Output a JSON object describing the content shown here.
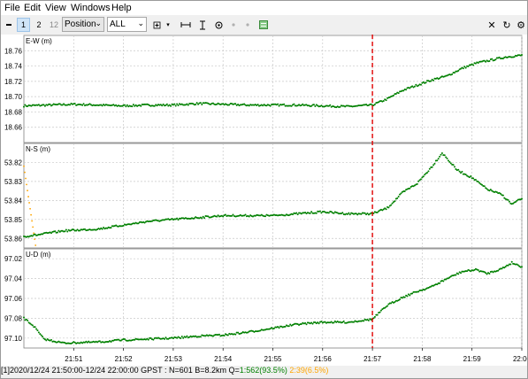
{
  "menu": [
    "File",
    "Edit",
    "View",
    "Windows",
    "Help"
  ],
  "toolbar": {
    "btn1": "1",
    "btn2": "2",
    "btn12": "12",
    "plot_type": "Position",
    "satellites": "ALL",
    "icons": [
      "menu-icon",
      "plus-icon",
      "dropdown-icon",
      "fit-horizontal-icon",
      "fit-vertical-icon",
      "center-icon",
      "dot-icon",
      "dot-icon",
      "map-icon",
      "close-icon",
      "refresh-icon",
      "settings-icon"
    ]
  },
  "colors": {
    "q1": "#008000",
    "q2": "#ffa500",
    "marker": "#e00000",
    "grid": "#c8c8c8"
  },
  "status": {
    "prefix": "[1]2020/12/24 21:50:00-12/24 22:00:00 GPST : N=601 B=8.2km Q=",
    "q1": "1:562(93.5%)",
    "q2": "2:39(6.5%)"
  },
  "chart_data": {
    "type": "scatter",
    "x_ticks": [
      "21:51",
      "21:52",
      "21:53",
      "21:54",
      "21:55",
      "21:56",
      "21:57",
      "21:58",
      "21:59",
      "22:00"
    ],
    "xlim": [
      "21:50:00",
      "22:00:00"
    ],
    "marker_time": "21:57:00",
    "panels": [
      {
        "label": "E-W (m)",
        "ylim": [
          18.64,
          18.78
        ],
        "yticks": [
          "18.66",
          "18.68",
          "18.70",
          "18.72",
          "18.74",
          "18.76"
        ],
        "points": [
          [
            0.0,
            18.688
          ],
          [
            0.5,
            18.689
          ],
          [
            1.0,
            18.69
          ],
          [
            1.5,
            18.689
          ],
          [
            2.0,
            18.688
          ],
          [
            2.5,
            18.689
          ],
          [
            3.0,
            18.689
          ],
          [
            3.5,
            18.691
          ],
          [
            4.0,
            18.69
          ],
          [
            4.5,
            18.689
          ],
          [
            5.0,
            18.689
          ],
          [
            5.5,
            18.689
          ],
          [
            6.0,
            18.688
          ],
          [
            6.5,
            18.687
          ],
          [
            7.0,
            18.689
          ],
          [
            7.3,
            18.697
          ],
          [
            7.6,
            18.708
          ],
          [
            7.9,
            18.715
          ],
          [
            8.2,
            18.722
          ],
          [
            8.5,
            18.727
          ],
          [
            8.8,
            18.737
          ],
          [
            9.1,
            18.744
          ],
          [
            9.4,
            18.748
          ],
          [
            9.7,
            18.752
          ],
          [
            10.0,
            18.754
          ]
        ]
      },
      {
        "label": "N-S (m)",
        "ylim": [
          53.865,
          53.81
        ],
        "yticks": [
          "53.82",
          "53.83",
          "53.84",
          "53.85",
          "53.86"
        ],
        "points": [
          [
            0.0,
            53.859
          ],
          [
            0.3,
            53.858
          ],
          [
            0.8,
            53.856
          ],
          [
            1.5,
            53.855
          ],
          [
            2.0,
            53.853
          ],
          [
            2.5,
            53.851
          ],
          [
            3.0,
            53.85
          ],
          [
            3.5,
            53.849
          ],
          [
            4.0,
            53.848
          ],
          [
            4.5,
            53.848
          ],
          [
            5.0,
            53.848
          ],
          [
            5.5,
            53.847
          ],
          [
            6.0,
            53.846
          ],
          [
            6.5,
            53.847
          ],
          [
            7.0,
            53.847
          ],
          [
            7.3,
            53.844
          ],
          [
            7.6,
            53.836
          ],
          [
            7.9,
            53.831
          ],
          [
            8.2,
            53.822
          ],
          [
            8.4,
            53.815
          ],
          [
            8.7,
            53.824
          ],
          [
            9.0,
            53.828
          ],
          [
            9.3,
            53.834
          ],
          [
            9.6,
            53.837
          ],
          [
            9.8,
            53.842
          ],
          [
            10.0,
            53.839
          ]
        ]
      },
      {
        "label": "U-D (m)",
        "ylim": [
          97.11,
          97.01
        ],
        "yticks": [
          "97.02",
          "97.04",
          "97.06",
          "97.08",
          "97.10"
        ],
        "points": [
          [
            0.0,
            97.08
          ],
          [
            0.2,
            97.088
          ],
          [
            0.4,
            97.101
          ],
          [
            0.8,
            97.105
          ],
          [
            1.5,
            97.104
          ],
          [
            2.0,
            97.102
          ],
          [
            2.5,
            97.101
          ],
          [
            3.0,
            97.1
          ],
          [
            3.5,
            97.098
          ],
          [
            4.0,
            97.097
          ],
          [
            4.5,
            97.094
          ],
          [
            5.0,
            97.09
          ],
          [
            5.5,
            97.086
          ],
          [
            6.0,
            97.084
          ],
          [
            6.5,
            97.084
          ],
          [
            7.0,
            97.081
          ],
          [
            7.3,
            97.067
          ],
          [
            7.6,
            97.059
          ],
          [
            7.9,
            97.053
          ],
          [
            8.2,
            97.048
          ],
          [
            8.5,
            97.04
          ],
          [
            8.8,
            97.033
          ],
          [
            9.1,
            97.031
          ],
          [
            9.3,
            97.035
          ],
          [
            9.6,
            97.03
          ],
          [
            9.8,
            97.024
          ],
          [
            10.0,
            97.028
          ]
        ]
      }
    ]
  }
}
